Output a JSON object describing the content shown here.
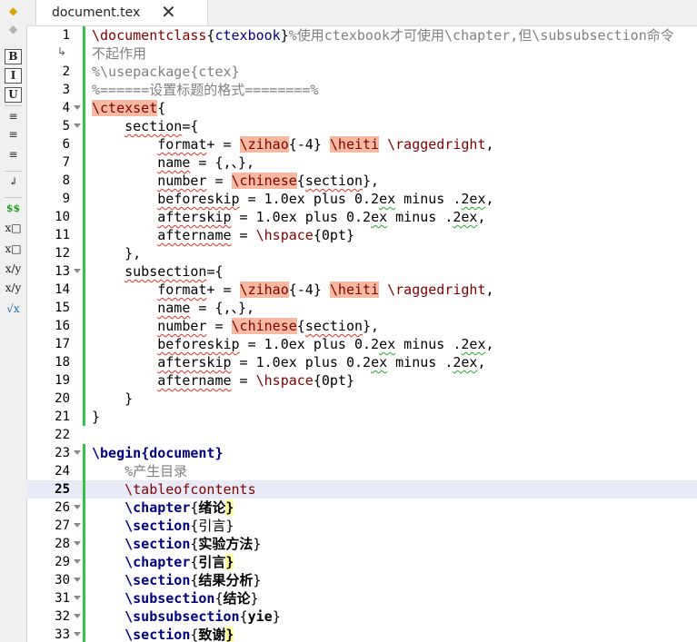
{
  "tab": {
    "title": "document.tex",
    "close_glyph": "✕"
  },
  "sidebar": {
    "buttons": [
      {
        "name": "bold-button-icon",
        "glyph": "B"
      },
      {
        "name": "italic-button-icon",
        "glyph": "I"
      },
      {
        "name": "underline-button-icon",
        "glyph": "U"
      },
      {
        "name": "align-left-icon",
        "glyph": "≡"
      },
      {
        "name": "align-center-icon",
        "glyph": "≡"
      },
      {
        "name": "align-right-icon",
        "glyph": "≡"
      },
      {
        "name": "newline-icon",
        "glyph": "↲"
      },
      {
        "name": "math-mode-icon",
        "glyph": "$$"
      },
      {
        "name": "subscript-icon",
        "glyph": "x□"
      },
      {
        "name": "superscript-icon",
        "glyph": "x□"
      },
      {
        "name": "fraction-icon",
        "glyph": "x/y"
      },
      {
        "name": "dfrac-icon",
        "glyph": "x/y"
      },
      {
        "name": "sqrt-icon",
        "glyph": "√x"
      }
    ]
  },
  "editor": {
    "current_line": 25,
    "lines": [
      {
        "n": "1",
        "bar": true,
        "tokens": [
          {
            "t": "\\documentclass",
            "c": "cmd"
          },
          {
            "t": "{"
          },
          {
            "t": "ctexbook",
            "c": "arg"
          },
          {
            "t": "}"
          },
          {
            "t": "%使用ctexbook才可使用\\chapter,但\\subsubsection命令",
            "c": "com"
          }
        ]
      },
      {
        "n": "",
        "wrap": true,
        "bar": true,
        "tokens": [
          {
            "t": "不起作用",
            "c": "com"
          }
        ]
      },
      {
        "n": "2",
        "bar": true,
        "tokens": [
          {
            "t": "%\\usepackage{ctex}",
            "c": "com"
          }
        ]
      },
      {
        "n": "3",
        "bar": true,
        "tokens": [
          {
            "t": "%======设置标题的格式========%",
            "c": "com"
          }
        ]
      },
      {
        "n": "4",
        "fold": true,
        "bar": true,
        "tokens": [
          {
            "t": "\\ctexset",
            "c": "cmdhl"
          },
          {
            "t": "{"
          }
        ]
      },
      {
        "n": "5",
        "fold": true,
        "bar": true,
        "tokens": [
          {
            "t": "    "
          },
          {
            "t": "section",
            "c": "sp"
          },
          {
            "t": "={"
          }
        ]
      },
      {
        "n": "6",
        "bar": true,
        "tokens": [
          {
            "t": "        "
          },
          {
            "t": "format",
            "c": "sp"
          },
          {
            "t": "+ = "
          },
          {
            "t": "\\zihao",
            "c": "cmdhl"
          },
          {
            "t": "{-4} "
          },
          {
            "t": "\\heiti",
            "c": "cmdhl"
          },
          {
            "t": " "
          },
          {
            "t": "\\raggedright",
            "c": "cmd"
          },
          {
            "t": ","
          }
        ]
      },
      {
        "n": "7",
        "bar": true,
        "tokens": [
          {
            "t": "        "
          },
          {
            "t": "name",
            "c": "sp"
          },
          {
            "t": " = {,、},"
          }
        ]
      },
      {
        "n": "8",
        "bar": true,
        "tokens": [
          {
            "t": "        "
          },
          {
            "t": "number",
            "c": "sp"
          },
          {
            "t": " = "
          },
          {
            "t": "\\chinese",
            "c": "cmdhl"
          },
          {
            "t": "{"
          },
          {
            "t": "section",
            "c": "sp"
          },
          {
            "t": "},"
          }
        ]
      },
      {
        "n": "9",
        "bar": true,
        "tokens": [
          {
            "t": "        "
          },
          {
            "t": "beforeskip",
            "c": "sp"
          },
          {
            "t": " = 1.0ex plus 0.2"
          },
          {
            "t": "ex",
            "c": "sp2"
          },
          {
            "t": " minus ."
          },
          {
            "t": "2ex",
            "c": "sp2"
          },
          {
            "t": ","
          }
        ]
      },
      {
        "n": "10",
        "bar": true,
        "tokens": [
          {
            "t": "        "
          },
          {
            "t": "afterskip",
            "c": "sp"
          },
          {
            "t": " = 1.0ex plus 0.2"
          },
          {
            "t": "ex",
            "c": "sp2"
          },
          {
            "t": " minus ."
          },
          {
            "t": "2ex",
            "c": "sp2"
          },
          {
            "t": ","
          }
        ]
      },
      {
        "n": "11",
        "bar": true,
        "tokens": [
          {
            "t": "        "
          },
          {
            "t": "aftername",
            "c": "sp"
          },
          {
            "t": " = "
          },
          {
            "t": "\\hspace",
            "c": "cmd"
          },
          {
            "t": "{0pt}"
          }
        ]
      },
      {
        "n": "12",
        "bar": true,
        "tokens": [
          {
            "t": "    },"
          }
        ]
      },
      {
        "n": "13",
        "fold": true,
        "bar": true,
        "tokens": [
          {
            "t": "    "
          },
          {
            "t": "subsection",
            "c": "sp"
          },
          {
            "t": "={"
          }
        ]
      },
      {
        "n": "14",
        "bar": true,
        "tokens": [
          {
            "t": "        "
          },
          {
            "t": "format",
            "c": "sp"
          },
          {
            "t": "+ = "
          },
          {
            "t": "\\zihao",
            "c": "cmdhl"
          },
          {
            "t": "{-4} "
          },
          {
            "t": "\\heiti",
            "c": "cmdhl"
          },
          {
            "t": " "
          },
          {
            "t": "\\raggedright",
            "c": "cmd"
          },
          {
            "t": ","
          }
        ]
      },
      {
        "n": "15",
        "bar": true,
        "tokens": [
          {
            "t": "        "
          },
          {
            "t": "name",
            "c": "sp"
          },
          {
            "t": " = {,、},"
          }
        ]
      },
      {
        "n": "16",
        "bar": true,
        "tokens": [
          {
            "t": "        "
          },
          {
            "t": "number",
            "c": "sp"
          },
          {
            "t": " = "
          },
          {
            "t": "\\chinese",
            "c": "cmdhl"
          },
          {
            "t": "{"
          },
          {
            "t": "section",
            "c": "sp"
          },
          {
            "t": "},"
          }
        ]
      },
      {
        "n": "17",
        "bar": true,
        "tokens": [
          {
            "t": "        "
          },
          {
            "t": "beforeskip",
            "c": "sp"
          },
          {
            "t": " = 1.0ex plus 0.2"
          },
          {
            "t": "ex",
            "c": "sp2"
          },
          {
            "t": " minus ."
          },
          {
            "t": "2ex",
            "c": "sp2"
          },
          {
            "t": ","
          }
        ]
      },
      {
        "n": "18",
        "bar": true,
        "tokens": [
          {
            "t": "        "
          },
          {
            "t": "afterskip",
            "c": "sp"
          },
          {
            "t": " = 1.0ex plus 0.2"
          },
          {
            "t": "ex",
            "c": "sp2"
          },
          {
            "t": " minus ."
          },
          {
            "t": "2ex",
            "c": "sp2"
          },
          {
            "t": ","
          }
        ]
      },
      {
        "n": "19",
        "bar": true,
        "tokens": [
          {
            "t": "        "
          },
          {
            "t": "aftername",
            "c": "sp"
          },
          {
            "t": " = "
          },
          {
            "t": "\\hspace",
            "c": "cmd"
          },
          {
            "t": "{0pt}"
          }
        ]
      },
      {
        "n": "20",
        "bar": true,
        "tokens": [
          {
            "t": "    }"
          }
        ]
      },
      {
        "n": "21",
        "bar": true,
        "tokens": [
          {
            "t": "}"
          }
        ]
      },
      {
        "n": "22",
        "tokens": []
      },
      {
        "n": "23",
        "fold": true,
        "bar": true,
        "tokens": [
          {
            "t": "\\begin",
            "c": "cmdb"
          },
          {
            "t": "{",
            "c": "cmdb"
          },
          {
            "t": "document",
            "c": "cmdb"
          },
          {
            "t": "}",
            "c": "cmdb"
          }
        ]
      },
      {
        "n": "24",
        "bar": true,
        "tokens": [
          {
            "t": "    "
          },
          {
            "t": "%产生目录",
            "c": "com"
          }
        ]
      },
      {
        "n": "25",
        "bar": true,
        "tokens": [
          {
            "t": "    "
          },
          {
            "t": "\\tableofcontents",
            "c": "cmd"
          }
        ]
      },
      {
        "n": "26",
        "fold": true,
        "bar": true,
        "tokens": [
          {
            "t": "    "
          },
          {
            "t": "\\chapter",
            "c": "cmdb"
          },
          {
            "t": "{"
          },
          {
            "t": "绪论",
            "c": "bold"
          },
          {
            "t": "}",
            "c": "bhl"
          }
        ]
      },
      {
        "n": "27",
        "fold": true,
        "bar": true,
        "tokens": [
          {
            "t": "    "
          },
          {
            "t": "\\section",
            "c": "cmdb"
          },
          {
            "t": "{引言}"
          }
        ]
      },
      {
        "n": "28",
        "fold": true,
        "bar": true,
        "tokens": [
          {
            "t": "    "
          },
          {
            "t": "\\section",
            "c": "cmdb"
          },
          {
            "t": "{"
          },
          {
            "t": "实验方法",
            "c": "bold"
          },
          {
            "t": "}"
          }
        ]
      },
      {
        "n": "29",
        "fold": true,
        "bar": true,
        "tokens": [
          {
            "t": "    "
          },
          {
            "t": "\\chapter",
            "c": "cmdb"
          },
          {
            "t": "{"
          },
          {
            "t": "引言",
            "c": "bold"
          },
          {
            "t": "}",
            "c": "bhl"
          }
        ]
      },
      {
        "n": "30",
        "fold": true,
        "bar": true,
        "tokens": [
          {
            "t": "    "
          },
          {
            "t": "\\section",
            "c": "cmdb"
          },
          {
            "t": "{"
          },
          {
            "t": "结果分析",
            "c": "bold"
          },
          {
            "t": "}"
          }
        ]
      },
      {
        "n": "31",
        "fold": true,
        "bar": true,
        "tokens": [
          {
            "t": "    "
          },
          {
            "t": "\\subsection",
            "c": "cmdb"
          },
          {
            "t": "{"
          },
          {
            "t": "结论",
            "c": "bold"
          },
          {
            "t": "}"
          }
        ]
      },
      {
        "n": "32",
        "fold": true,
        "bar": true,
        "tokens": [
          {
            "t": "    "
          },
          {
            "t": "\\subsubsection",
            "c": "cmdb"
          },
          {
            "t": "{"
          },
          {
            "t": "yie",
            "c": "bold"
          },
          {
            "t": "}"
          }
        ]
      },
      {
        "n": "33",
        "fold": true,
        "bar": true,
        "tokens": [
          {
            "t": "    "
          },
          {
            "t": "\\section",
            "c": "cmdb"
          },
          {
            "t": "{"
          },
          {
            "t": "致谢",
            "c": "bold"
          },
          {
            "t": "}",
            "c": "bhl"
          }
        ]
      }
    ]
  },
  "colors": {
    "command": "#800000",
    "keyword": "#000080",
    "comment": "#808080",
    "highlight": "#f7b9a2",
    "brace_match": "#fdfda0",
    "change_bar": "#3ac04a",
    "current_line": "#e9eaf7"
  }
}
